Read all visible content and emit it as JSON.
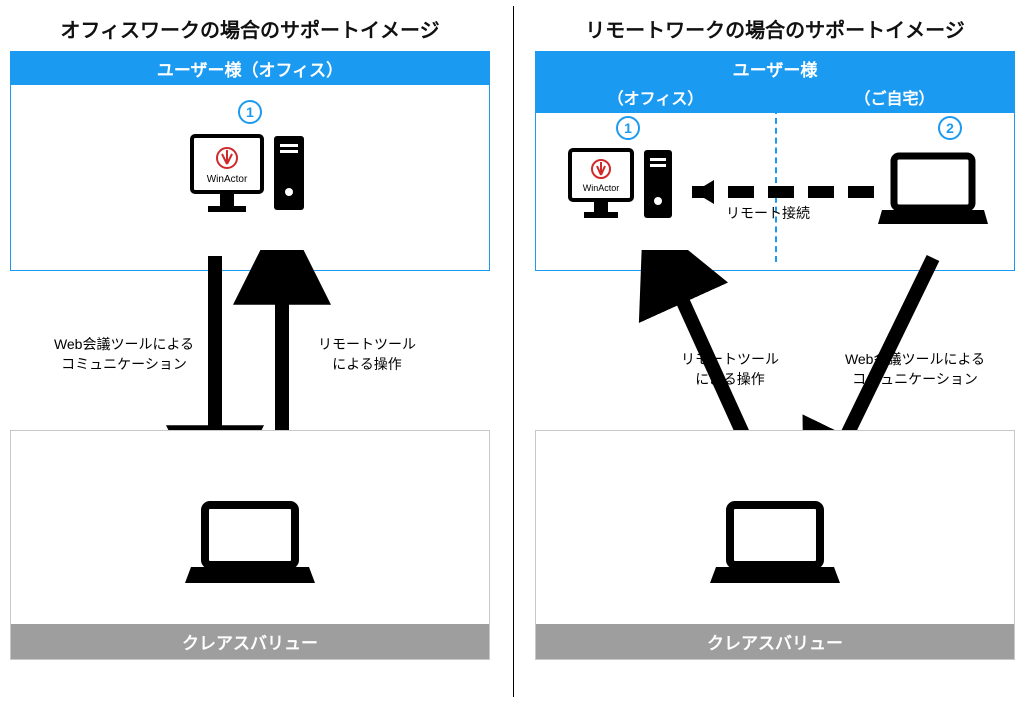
{
  "left": {
    "title": "オフィスワークの場合のサポートイメージ",
    "user_header": "ユーザー様（オフィス）",
    "num1": "1",
    "winactor": "WinActor",
    "arrow1_label_line1": "Web会議ツールによる",
    "arrow1_label_line2": "コミュニケーション",
    "arrow2_label_line1": "リモートツール",
    "arrow2_label_line2": "による操作",
    "provider": "クレアスバリュー"
  },
  "right": {
    "title": "リモートワークの場合のサポートイメージ",
    "user_header": "ユーザー様",
    "user_sub_left": "（オフィス）",
    "user_sub_right": "（ご自宅）",
    "num1": "1",
    "num2": "2",
    "winactor": "WinActor",
    "remote_connect": "リモート接続",
    "arrow1_label_line1": "リモートツール",
    "arrow1_label_line2": "による操作",
    "arrow2_label_line1": "Web会議ツールによる",
    "arrow2_label_line2": "コミュニケーション",
    "provider": "クレアスバリュー"
  },
  "colors": {
    "accent": "#1b9af2",
    "grey": "#9e9e9e"
  }
}
